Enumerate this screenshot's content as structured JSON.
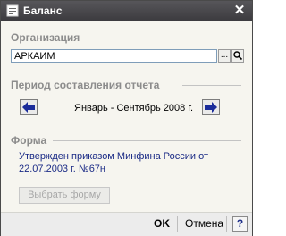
{
  "window": {
    "title": "Баланс",
    "close_icon": "close-icon"
  },
  "organization": {
    "label": "Организация",
    "value": "АРКАИМ",
    "select_button": "...",
    "open_icon": "magnifier-icon"
  },
  "period": {
    "label": "Период составления отчета",
    "value": "Январь - Сентябрь 2008 г.",
    "prev_icon": "arrow-left-icon",
    "next_icon": "arrow-right-icon"
  },
  "form": {
    "label": "Форма",
    "description": "Утвержден приказом Минфина России от 22.07.2003 г. №67н",
    "choose_button": "Выбрать форму"
  },
  "footer": {
    "ok": "OK",
    "cancel": "Отмена",
    "help": "?"
  },
  "colors": {
    "titlebar": "#4a494d",
    "accent_arrow": "#1a2b9a",
    "form_text": "#1b2b86"
  }
}
